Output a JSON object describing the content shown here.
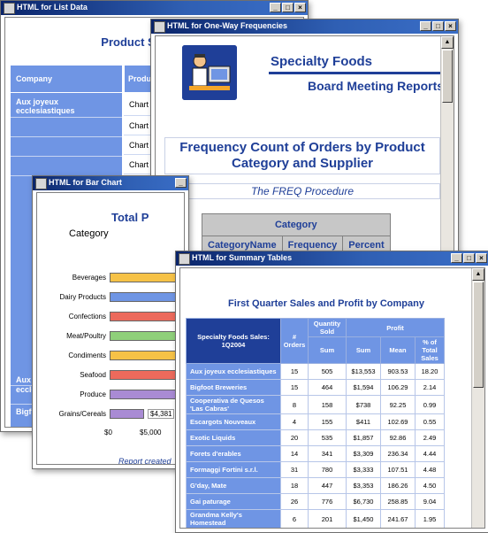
{
  "list_window": {
    "title": "HTML for List Data",
    "page_title": "Product Sales and",
    "col_company": "Company",
    "col_product": "Produ",
    "first_company": "Aux joyeux ecclesiastiques",
    "chart_cells": [
      "Chart",
      "Chart",
      "Chart",
      "Chart"
    ],
    "lower_company_1": "Aux",
    "lower_company_1b": "eccle",
    "lower_company_2": "Bigf"
  },
  "bar_window": {
    "title": "HTML for Bar Chart",
    "page_title": "Total P",
    "footer": "Report created"
  },
  "freq_window": {
    "title": "HTML for One-Way Frequencies",
    "banner_line1": "Specialty Foods",
    "banner_line2": "Board Meeting Reports",
    "report_title": "Frequency Count of Orders by Product Category and Supplier",
    "procedure": "The FREQ Procedure",
    "table_group_header": "Category",
    "columns": [
      "CategoryName",
      "Frequency",
      "Percent"
    ]
  },
  "summary_window": {
    "title": "HTML for Summary Tables",
    "report_title": "First Quarter Sales and Profit by Company",
    "header_main": "Specialty Foods Sales: 1Q2004",
    "header_orders": "# Orders",
    "header_qty": "Quantity Sold",
    "header_profit": "Profit",
    "header_sum": "Sum",
    "header_sum2": "Sum",
    "header_mean": "Mean",
    "header_pct": "% of Total Sales",
    "rows": [
      {
        "company": "Aux joyeux ecclesiastiques",
        "orders": "15",
        "qty": "505",
        "sum": "$13,553",
        "mean": "903.53",
        "pct": "18.20"
      },
      {
        "company": "Bigfoot Breweries",
        "orders": "15",
        "qty": "464",
        "sum": "$1,594",
        "mean": "106.29",
        "pct": "2.14"
      },
      {
        "company": "Cooperativa de Quesos 'Las Cabras'",
        "orders": "8",
        "qty": "158",
        "sum": "$738",
        "mean": "92.25",
        "pct": "0.99"
      },
      {
        "company": "Escargots Nouveaux",
        "orders": "4",
        "qty": "155",
        "sum": "$411",
        "mean": "102.69",
        "pct": "0.55"
      },
      {
        "company": "Exotic Liquids",
        "orders": "20",
        "qty": "535",
        "sum": "$1,857",
        "mean": "92.86",
        "pct": "2.49"
      },
      {
        "company": "Forets d'erables",
        "orders": "14",
        "qty": "341",
        "sum": "$3,309",
        "mean": "236.34",
        "pct": "4.44"
      },
      {
        "company": "Formaggi Fortini s.r.l.",
        "orders": "31",
        "qty": "780",
        "sum": "$3,333",
        "mean": "107.51",
        "pct": "4.48"
      },
      {
        "company": "G'day, Mate",
        "orders": "18",
        "qty": "447",
        "sum": "$3,353",
        "mean": "186.26",
        "pct": "4.50"
      },
      {
        "company": "Gai paturage",
        "orders": "26",
        "qty": "776",
        "sum": "$6,730",
        "mean": "258.85",
        "pct": "9.04"
      },
      {
        "company": "Grandma Kelly's Homestead",
        "orders": "6",
        "qty": "201",
        "sum": "$1,450",
        "mean": "241.67",
        "pct": "1.95"
      }
    ]
  },
  "chart_data": {
    "type": "bar",
    "orientation": "horizontal",
    "title": "Total P",
    "ylabel": "Category",
    "categories": [
      "Beverages",
      "Dairy Products",
      "Confections",
      "Meat/Poultry",
      "Condiments",
      "Seafood",
      "Produce",
      "Grains/Cereals"
    ],
    "value_labels": [
      "",
      "",
      "",
      "",
      "",
      "",
      "",
      "$4,381"
    ],
    "values": [
      null,
      null,
      null,
      null,
      null,
      null,
      null,
      4381
    ],
    "x_ticks": [
      "$0",
      "$5,000",
      "$"
    ],
    "colors": [
      "#f6c247",
      "#6f95e4",
      "#ec6a5c",
      "#8fd07a",
      "#f6c247",
      "#ec6a5c",
      "#a98bd4",
      "#a98bd4"
    ]
  }
}
